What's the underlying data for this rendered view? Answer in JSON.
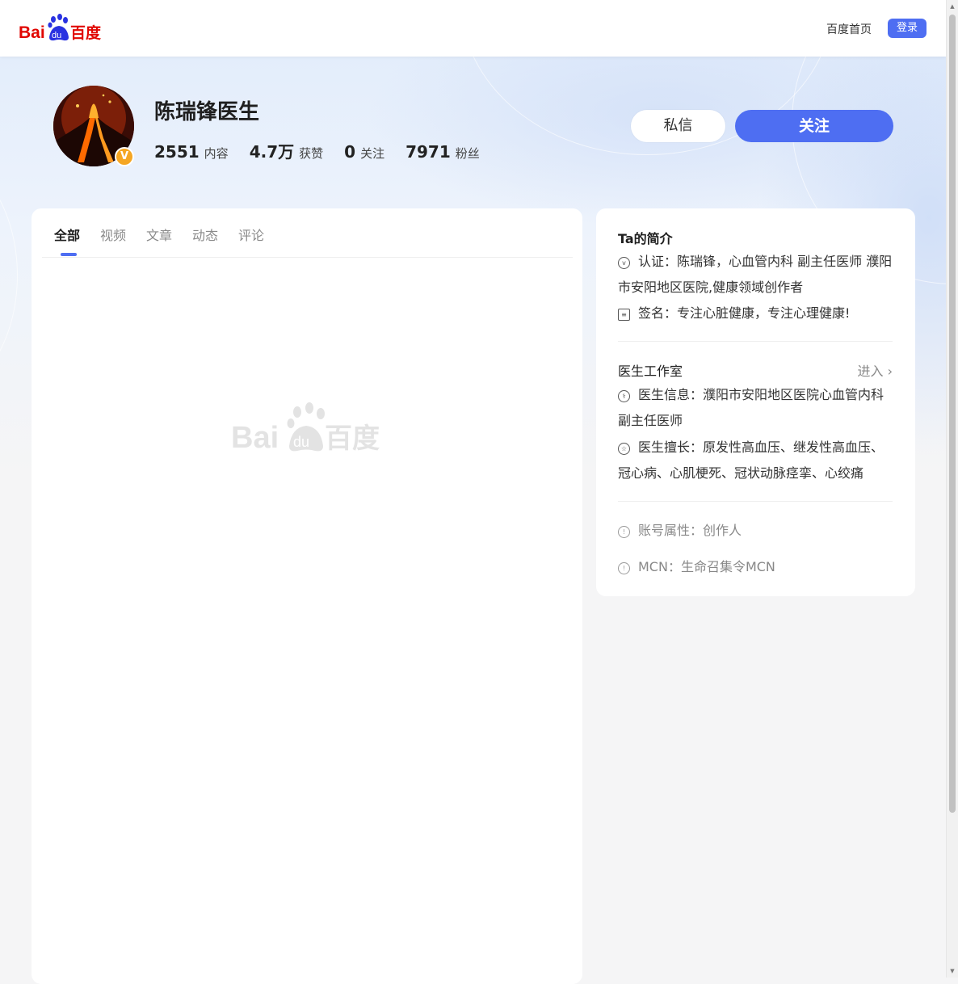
{
  "header": {
    "logo_text": "Bai du 百度",
    "home_link": "百度首页",
    "login_button": "登录"
  },
  "profile": {
    "name": "陈瑞锋医生",
    "verified_badge": "V",
    "stats": [
      {
        "value": "2551",
        "label": "内容"
      },
      {
        "value": "4.7万",
        "label": "获赞"
      },
      {
        "value": "0",
        "label": "关注"
      },
      {
        "value": "7971",
        "label": "粉丝"
      }
    ],
    "message_button": "私信",
    "follow_button": "关注"
  },
  "tabs": [
    {
      "label": "全部",
      "active": true
    },
    {
      "label": "视频",
      "active": false
    },
    {
      "label": "文章",
      "active": false
    },
    {
      "label": "动态",
      "active": false
    },
    {
      "label": "评论",
      "active": false
    }
  ],
  "intro": {
    "title": "Ta的简介",
    "certification": "认证：陈瑞锋，心血管内科 副主任医师 濮阳市安阳地区医院,健康领域创作者",
    "signature": "签名：专注心脏健康，专注心理健康!"
  },
  "studio": {
    "title": "医生工作室",
    "enter_link": "进入",
    "doctor_info": "医生信息：濮阳市安阳地区医院心血管内科副主任医师",
    "specialty": "医生擅长：原发性高血压、继发性高血压、冠心病、心肌梗死、冠状动脉痉挛、心绞痛"
  },
  "account": {
    "property": "账号属性：创作人",
    "mcn": "MCN：生命召集令MCN"
  },
  "colors": {
    "accent": "#4e6ef2",
    "badge": "#f5a623",
    "baidu_red": "#e10601",
    "baidu_blue": "#2932e1"
  }
}
